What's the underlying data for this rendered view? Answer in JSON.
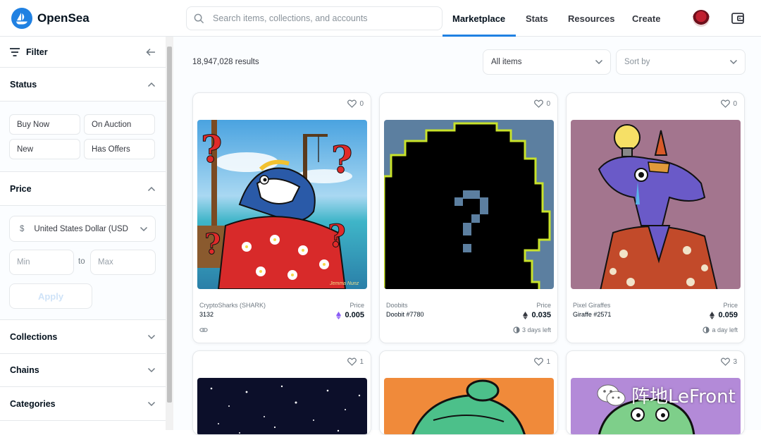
{
  "header": {
    "brand": "OpenSea",
    "search_placeholder": "Search items, collections, and accounts",
    "nav": [
      "Marketplace",
      "Stats",
      "Resources",
      "Create"
    ],
    "active_nav": "Marketplace",
    "accent_color": "#2081e2"
  },
  "sidebar": {
    "filter_label": "Filter",
    "status": {
      "title": "Status",
      "options": [
        "Buy Now",
        "On Auction",
        "New",
        "Has Offers"
      ]
    },
    "price": {
      "title": "Price",
      "currency_symbol": "$",
      "currency": "United States Dollar (USD)",
      "min_placeholder": "Min",
      "to_label": "to",
      "max_placeholder": "Max",
      "apply_label": "Apply"
    },
    "sections": [
      "Collections",
      "Chains",
      "Categories"
    ]
  },
  "main": {
    "results": "18,947,028 results",
    "items_filter": "All items",
    "sort_placeholder": "Sort by",
    "price_label": "Price",
    "cards": [
      {
        "favorites": "0",
        "collection": "CryptoSharks (SHARK)",
        "name": "3132",
        "price": "0.005",
        "currency_icon": "eth-purple-icon",
        "footer": "",
        "footer_icon": "link-icon"
      },
      {
        "favorites": "0",
        "collection": "Doobits",
        "name": "Doobit #7780",
        "price": "0.035",
        "currency_icon": "eth-icon",
        "footer": "3 days left",
        "footer_icon": "timer-icon"
      },
      {
        "favorites": "0",
        "collection": "Pixel Giraffes",
        "name": "Giraffe #2571",
        "price": "0.059",
        "currency_icon": "eth-icon",
        "footer": "a day left",
        "footer_icon": "timer-icon"
      },
      {
        "favorites": "1"
      },
      {
        "favorites": "1"
      },
      {
        "favorites": "3"
      }
    ],
    "art_signature": "Jemma Nunz"
  },
  "watermark": "阵地LeFront"
}
